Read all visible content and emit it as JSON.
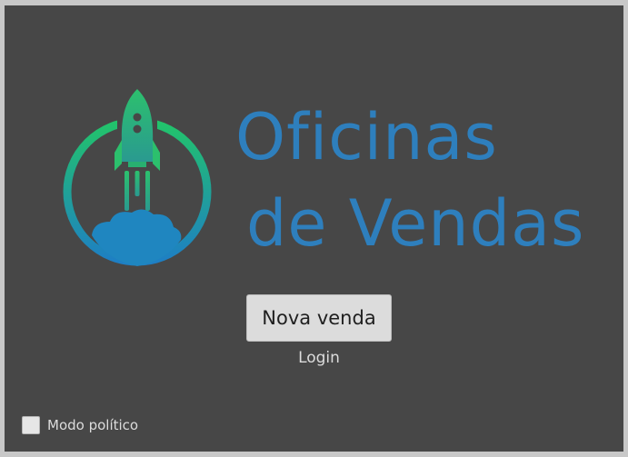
{
  "logo": {
    "title_line_1": "Oficinas",
    "title_line_2": "de Vendas",
    "icon": "rocket-icon",
    "colors": {
      "title": "#2e7fbd",
      "gradient_top": "#26c06a",
      "gradient_bottom": "#1e7fc4"
    }
  },
  "actions": {
    "new_sale_label": "Nova venda",
    "login_label": "Login"
  },
  "options": {
    "political_mode_label": "Modo político",
    "political_mode_checked": false
  },
  "colors": {
    "background": "#474747",
    "frame": "#c8c8c8"
  }
}
